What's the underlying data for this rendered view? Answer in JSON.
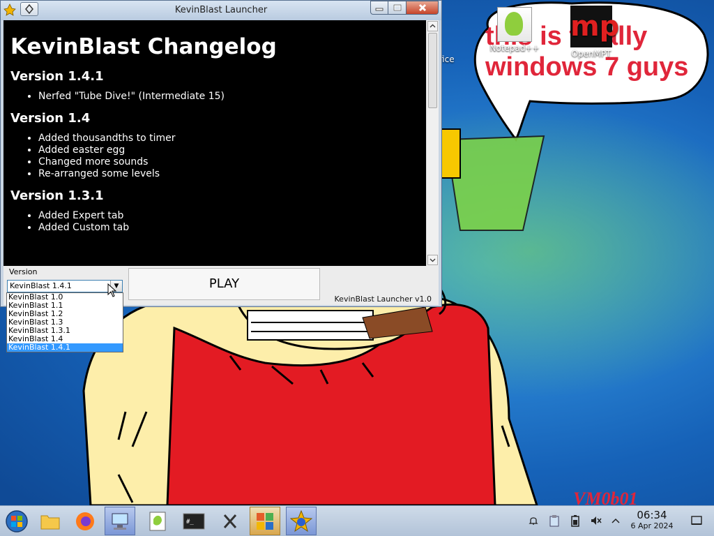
{
  "window": {
    "title": "KevinBlast Launcher",
    "changelog": {
      "heading": "KevinBlast Changelog",
      "sections": [
        {
          "version": "Version 1.4.1",
          "items": [
            "Nerfed \"Tube Dive!\" (Intermediate 15)"
          ]
        },
        {
          "version": "Version 1.4",
          "items": [
            "Added thousandths to timer",
            "Added easter egg",
            "Changed more sounds",
            "Re-arranged some levels"
          ]
        },
        {
          "version": "Version 1.3.1",
          "items": [
            "Added Expert tab",
            "Added Custom tab"
          ]
        }
      ]
    },
    "version_label": "Version",
    "selected_version": "KevinBlast 1.4.1",
    "version_options": [
      "KevinBlast 1.0",
      "KevinBlast 1.1",
      "KevinBlast 1.2",
      "KevinBlast 1.3",
      "KevinBlast 1.3.1",
      "KevinBlast 1.4",
      "KevinBlast 1.4.1"
    ],
    "play_label": "PLAY",
    "footer": "KevinBlast Launcher v1.0"
  },
  "desktop": {
    "icons": [
      {
        "label": "Notepad++",
        "icon": "notepadpp-icon"
      },
      {
        "label": "OpenMPT",
        "icon": "openmpt-icon"
      },
      {
        "label": "ffice",
        "icon": "office-icon"
      }
    ],
    "openmpt_glyph": "mp",
    "speech_line1": "this is totally",
    "speech_line2": "windows 7 guys",
    "signature": "VM0b01"
  },
  "taskbar": {
    "buttons": [
      "start-orb-icon",
      "file-explorer-icon",
      "firefox-icon",
      "network-computer-icon",
      "notepadpp-icon",
      "terminal-icon",
      "xfce-icon",
      "office-suite-icon",
      "kevinblast-icon"
    ],
    "tray": [
      "notification-bell-icon",
      "clipboard-icon",
      "battery-icon",
      "volume-muted-icon",
      "chevron-up-icon",
      "show-desktop-icon"
    ],
    "clock_time": "06:34",
    "clock_date": "6 Apr 2024"
  },
  "colors": {
    "title_bar": "#c9d5e3",
    "changelog_bg": "#000000",
    "selection": "#3399ff",
    "speech_text": "#e0263a"
  }
}
